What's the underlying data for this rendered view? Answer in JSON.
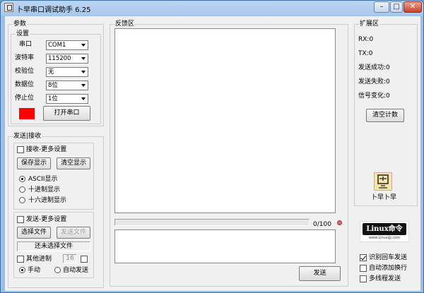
{
  "window": {
    "title": "卜早串口调试助手 6.25",
    "minimize": "–",
    "maximize": "□",
    "close": "✕"
  },
  "params": {
    "group": "参数",
    "settings": "设置",
    "port_label": "串口",
    "port_value": "COM1",
    "baud_label": "波特率",
    "baud_value": "115200",
    "parity_label": "校验位",
    "parity_value": "无",
    "databits_label": "数据位",
    "databits_value": "8位",
    "stopbits_label": "停止位",
    "stopbits_value": "1位",
    "status_color": "#ff0000",
    "open_button": "打开串口"
  },
  "sendrecv": {
    "group": "发送|接收",
    "recv_more": "接收-更多设置",
    "save_display": "保存显示",
    "clear_display": "清空显示",
    "ascii": "ASCII显示",
    "dec": "十进制显示",
    "hex": "十六进制显示",
    "send_more": "发送-更多设置",
    "select_file": "选择文件",
    "send_file": "发送文件",
    "no_file": "还未选择文件",
    "other_base": "其他进制",
    "base_value": "16",
    "manual": "手动",
    "auto_send": "自动发送"
  },
  "feedback": {
    "group": "反馈区",
    "counter": "0/100",
    "send_button": "发送"
  },
  "ext": {
    "group": "扩展区",
    "rx": "RX:0",
    "tx": "TX:0",
    "send_ok": "发送成功:0",
    "send_fail": "发送失败:0",
    "signal": "信号变化:0",
    "clear_count": "清空计数",
    "logo_label": "卜早卜早",
    "linux_logo": "Linux命令",
    "linux_url": "www.Linux@.com",
    "recognize_enter": "识别回车发送",
    "auto_newline": "自动添加换行",
    "multithread": "多线程发送"
  }
}
